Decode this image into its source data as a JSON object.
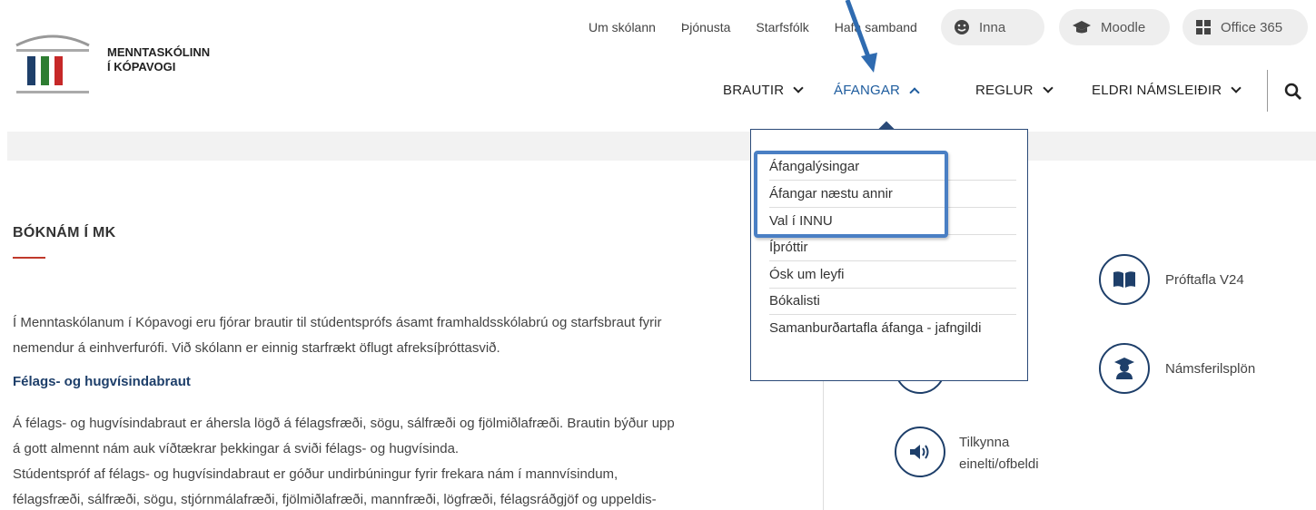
{
  "logo": {
    "line1": "MENNTASKÓLINN",
    "line2": "Í KÓPAVOGI"
  },
  "top_links": [
    "Um skólann",
    "Þjónusta",
    "Starfsfólk",
    "Hafa samband"
  ],
  "pills": {
    "inna": "Inna",
    "moodle": "Moodle",
    "office": "Office 365"
  },
  "main_nav": {
    "brautir": "BRAUTIR",
    "afangar": "ÁFANGAR",
    "reglur": "REGLUR",
    "eldri": "ELDRI NÁMSLEIÐIR"
  },
  "dropdown": [
    "Áfangalýsingar",
    "Áfangar næstu annir",
    "Val í INNU",
    "Íþróttir",
    "Ósk um leyfi",
    "Bókalisti",
    "Samanburðartafla áfanga - jafngildi"
  ],
  "content": {
    "title": "BÓKNÁM Í MK",
    "intro_line1": "Í Menntaskólanum í Kópavogi eru fjórar brautir til stúdentsprófs ásamt framhaldsskólabrú og starfsbraut fyrir",
    "intro_line2": "nemendur á einhverfurófi. Við skólann er einnig starfrækt öflugt afreksíþróttasvið.",
    "subhead": "Félags- og hugvísindabraut",
    "p2_line1": "Á félags- og hugvísindabraut er áhersla lögð á félagsfræði, sögu, sálfræði og fjölmiðlafræði. Brautin býður upp",
    "p2_line2": "á gott almennt nám auk víðtækrar þekkingar á sviði félags- og hugvísinda.",
    "p3_line1": "Stúdentspróf af félags- og hugvísindabraut er góður undirbúningur fyrir frekara nám í mannvísindum,",
    "p3_line2": "félagsfræði, sálfræði, sögu, stjórnmálafræði, fjölmiðlafræði, mannfræði, lögfræði, félagsráðgjöf og uppeldis-"
  },
  "quick_links": {
    "proftafla": "Próftafla V24",
    "namsferil": "Námsferilsplön",
    "tilkynna_1": "Tilkynna",
    "tilkynna_2": "einelti/ofbeldi"
  },
  "colors": {
    "brand_blue": "#1e3f6a",
    "active_nav": "#1e5c9e",
    "highlight": "#4a7fc4",
    "accent_red": "#c0392b"
  }
}
